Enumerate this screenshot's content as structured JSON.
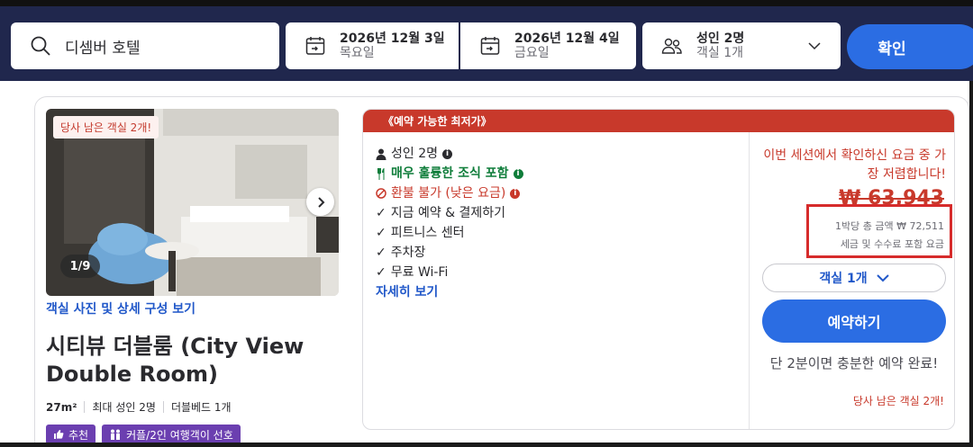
{
  "search": {
    "query": "디셈버 호텔",
    "checkin_date": "2026년 12월 3일",
    "checkin_day": "목요일",
    "checkout_date": "2026년 12월 4일",
    "checkout_day": "금요일",
    "guests_main": "성인 2명",
    "guests_sub": "객실 1개",
    "confirm_label": "확인"
  },
  "room": {
    "urgency_badge": "당사 남은 객실 2개!",
    "photo_counter": "1/9",
    "photo_link": "객실 사진 및 상세 구성 보기",
    "title": "시티뷰 더블룸 (City View Double Room)",
    "size": "27m²",
    "max_guests": "최대 성인 2명",
    "bed": "더블베드 1개",
    "tags": [
      "추천",
      "커플/2인 여행객이 선호"
    ]
  },
  "offer": {
    "banner": "《예약 가능한 최저가》",
    "features": {
      "guests": "성인 2명",
      "breakfast": "매우 훌륭한 조식 포함",
      "refund": "환불 불가 (낮은 요금)",
      "pay_now": "지금 예약 & 결제하기",
      "fitness": "피트니스 센터",
      "parking": "주차장",
      "wifi": "무료 Wi-Fi"
    },
    "more_link": "자세히 보기",
    "cheapest_msg": "이번 세션에서 확인하신 요금 중 가장 저렴합니다!",
    "old_price": "₩ 63,943",
    "per_night": "1박당 총 금액 ₩ 72,511",
    "tax_note": "세금 및 수수료 포함 요금",
    "rooms_select": "객실 1개",
    "book_label": "예약하기",
    "quick_msg": "단 2분이면 충분한 예약 완료!",
    "rooms_left": "당사 남은 객실 2개!"
  },
  "colors": {
    "nav_bg": "#20274d",
    "primary": "#2b6de3",
    "alert": "#c8392b",
    "green": "#0f7d3a",
    "tag": "#6b3fb0"
  }
}
